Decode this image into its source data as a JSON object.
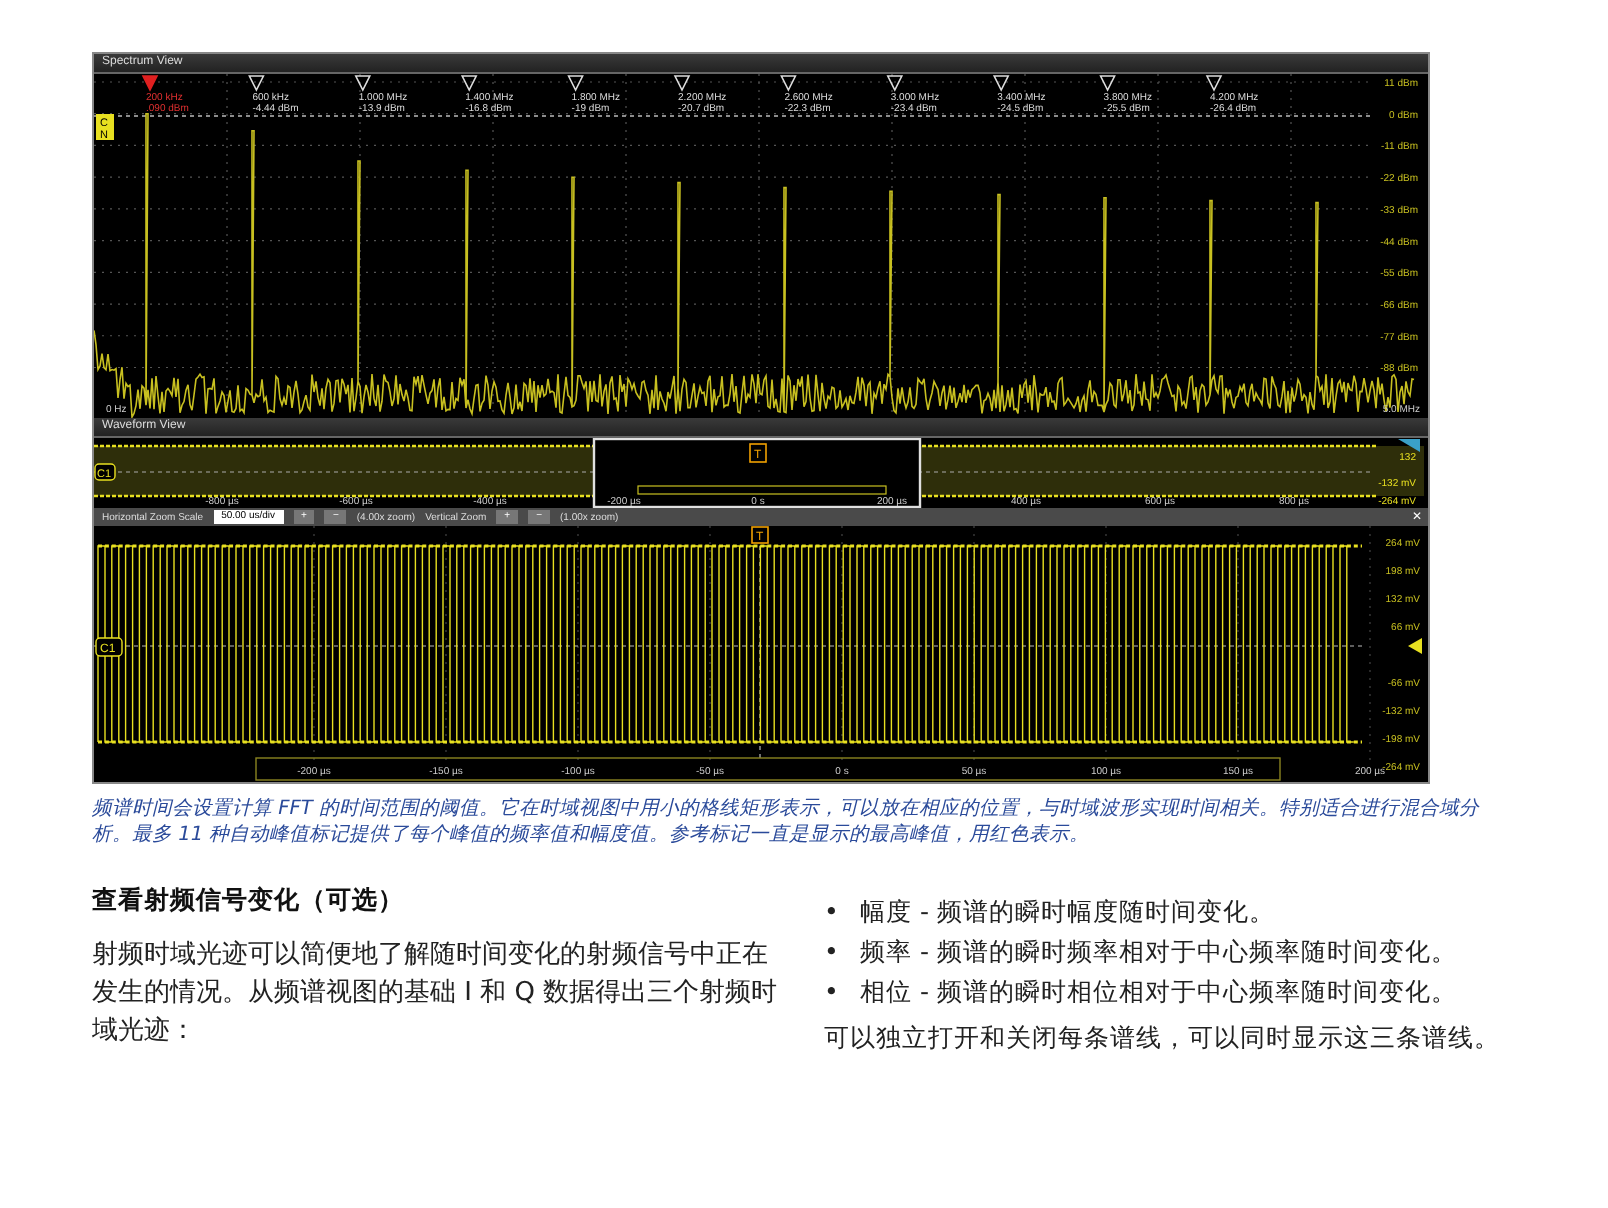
{
  "spectrum_view": {
    "title": "Spectrum View",
    "channel_badge": [
      "C",
      "N"
    ],
    "markers": [
      {
        "frequency": "200 kHz",
        "amplitude": ".090 dBm",
        "reference": true
      },
      {
        "frequency": "600 kHz",
        "amplitude": "-4.44 dBm",
        "reference": false
      },
      {
        "frequency": "1.000 MHz",
        "amplitude": "-13.9 dBm",
        "reference": false
      },
      {
        "frequency": "1.400 MHz",
        "amplitude": "-16.8 dBm",
        "reference": false
      },
      {
        "frequency": "1.800 MHz",
        "amplitude": "-19 dBm",
        "reference": false
      },
      {
        "frequency": "2.200 MHz",
        "amplitude": "-20.7 dBm",
        "reference": false
      },
      {
        "frequency": "2.600 MHz",
        "amplitude": "-22.3 dBm",
        "reference": false
      },
      {
        "frequency": "3.000 MHz",
        "amplitude": "-23.4 dBm",
        "reference": false
      },
      {
        "frequency": "3.400 MHz",
        "amplitude": "-24.5 dBm",
        "reference": false
      },
      {
        "frequency": "3.800 MHz",
        "amplitude": "-25.5 dBm",
        "reference": false
      },
      {
        "frequency": "4.200 MHz",
        "amplitude": "-26.4 dBm",
        "reference": false
      }
    ],
    "y_labels": [
      "11 dBm",
      "0 dBm",
      "-11 dBm",
      "-22 dBm",
      "-33 dBm",
      "-44 dBm",
      "-55 dBm",
      "-66 dBm",
      "-77 dBm",
      "-88 dBm"
    ],
    "start_label": "0 Hz",
    "end_label": "5.0 MHz"
  },
  "waveform_view": {
    "title": "Waveform View",
    "channel_label": "C1",
    "trigger_label": "T",
    "x_labels": [
      "-800 µs",
      "-600 µs",
      "-400 µs",
      "-200 µs",
      "0 s",
      "200 µs",
      "400 µs",
      "600 µs",
      "800 µs"
    ],
    "y_labels": [
      "132",
      "-132 mV",
      "-264 mV"
    ],
    "zoom_bar": {
      "horizontal_label": "Horizontal Zoom Scale",
      "scale": "50.00 us/div",
      "zoom_in": "+",
      "zoom_out": "−",
      "horizontal_zoom": "(4.00x zoom)",
      "vertical_label": "Vertical Zoom",
      "vertical_zoom": "(1.00x zoom)",
      "close": "✕"
    },
    "zoomed": {
      "channel_label": "C1",
      "trigger_label": "T",
      "x_labels": [
        "-200 µs",
        "-150 µs",
        "-100 µs",
        "-50 µs",
        "0 s",
        "50 µs",
        "100 µs",
        "150 µs",
        "200 µs"
      ],
      "y_labels": [
        "264 mV",
        "198 mV",
        "132 mV",
        "66 mV",
        "-66 mV",
        "-132 mV",
        "-198 mV",
        "-264 mV"
      ]
    }
  },
  "caption": "频谱时间会设置计算 FFT 的时间范围的阈值。它在时域视图中用小的格线矩形表示，可以放在相应的位置，与时域波形实现时间相关。特别适合进行混合域分析。最多 11 种自动峰值标记提供了每个峰值的频率值和幅度值。参考标记一直是显示的最高峰值，用红色表示。",
  "section": {
    "heading": "查看射频信号变化（可选）",
    "paragraph": "射频时域光迹可以简便地了解随时间变化的射频信号中正在发生的情况。从频谱视图的基础 I 和 Q 数据得出三个射频时域光迹：",
    "bullets": [
      {
        "mark": "•",
        "text": "幅度 - 频谱的瞬时幅度随时间变化。"
      },
      {
        "mark": "•",
        "text": "频率 - 频谱的瞬时频率相对于中心频率随时间变化。"
      },
      {
        "mark": "•",
        "text": "相位 - 频谱的瞬时相位相对于中心频率随时间变化。"
      }
    ],
    "closing": "可以独立打开和关闭每条谱线，可以同时显示这三条谱线。"
  }
}
